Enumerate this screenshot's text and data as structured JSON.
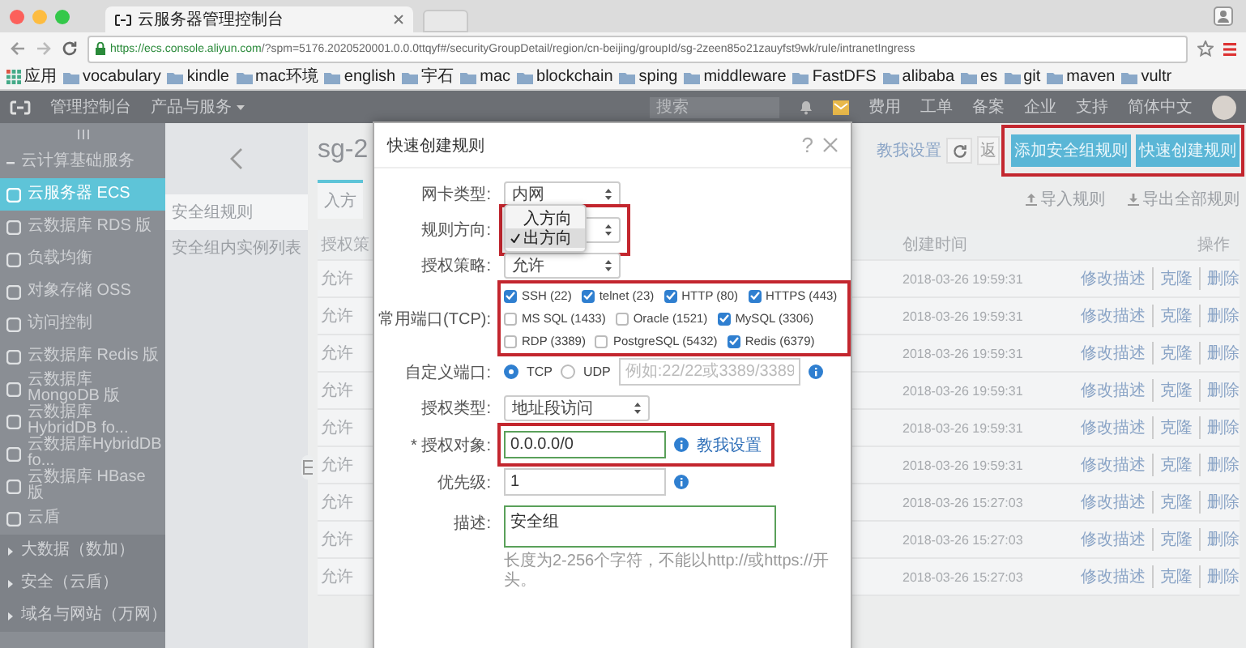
{
  "browser": {
    "tab_title": "云服务器管理控制台",
    "url_origin": "https://ecs.console.aliyun.com",
    "url_path": "/?spm=5176.2020520001.0.0.0ttqyf#/securityGroupDetail/region/cn-beijing/groupId/sg-2zeen85o21zauyfst9wk/rule/intranetIngress",
    "apps": "应用",
    "bookmarks": [
      "vocabulary",
      "kindle",
      "mac环境",
      "english",
      "宇石",
      "mac",
      "blockchain",
      "sping",
      "middleware",
      "FastDFS",
      "alibaba",
      "es",
      "git",
      "maven",
      "vultr"
    ]
  },
  "console_nav": {
    "home": "管理控制台",
    "products": "产品与服务",
    "search_placeholder": "搜索",
    "links": [
      "费用",
      "工单",
      "备案",
      "企业",
      "支持",
      "简体中文"
    ]
  },
  "sidebar": {
    "items": [
      {
        "label": "云计算基础服务",
        "kind": "group",
        "expanded": true,
        "selected": false
      },
      {
        "label": "云服务器 ECS",
        "kind": "item",
        "selected": true
      },
      {
        "label": "云数据库 RDS 版",
        "kind": "item",
        "selected": false
      },
      {
        "label": "负载均衡",
        "kind": "item",
        "selected": false
      },
      {
        "label": "对象存储 OSS",
        "kind": "item",
        "selected": false
      },
      {
        "label": "访问控制",
        "kind": "item",
        "selected": false
      },
      {
        "label": "云数据库 Redis 版",
        "kind": "item",
        "selected": false
      },
      {
        "label": "云数据库 MongoDB 版",
        "kind": "item",
        "selected": false
      },
      {
        "label": "云数据库 HybridDB fo...",
        "kind": "item",
        "selected": false
      },
      {
        "label": "云数据库HybridDB fo...",
        "kind": "item",
        "selected": false
      },
      {
        "label": "云数据库 HBase 版",
        "kind": "item",
        "selected": false
      },
      {
        "label": "云盾",
        "kind": "item",
        "selected": false
      },
      {
        "label": "大数据（数加）",
        "kind": "group",
        "expanded": false,
        "selected": false
      },
      {
        "label": "安全（云盾）",
        "kind": "group",
        "expanded": false,
        "selected": false
      },
      {
        "label": "域名与网站（万网）",
        "kind": "group",
        "expanded": false,
        "selected": false
      }
    ]
  },
  "subnav": {
    "items": [
      {
        "label": "安全组规则",
        "selected": true
      },
      {
        "label": "安全组内实例列表",
        "selected": false
      }
    ]
  },
  "main": {
    "title": "sg-2",
    "help_link": "教我设置",
    "back_button": "返",
    "highlighted": true,
    "buttons": [
      {
        "label": "添加安全组规则"
      },
      {
        "label": "快速创建规则"
      }
    ],
    "tabs": [
      {
        "label": "入方",
        "selected": true
      }
    ],
    "import": "导入规则",
    "export": "导出全部规则",
    "table": {
      "columns": [
        {
          "label": "授权策"
        },
        {
          "label": "创建时间"
        },
        {
          "label": "操作"
        }
      ],
      "rows": [
        {
          "policy": "允许",
          "created": "2018-03-26 19:59:31",
          "actions": [
            "修改描述",
            "克隆",
            "删除"
          ]
        },
        {
          "policy": "允许",
          "created": "2018-03-26 19:59:31",
          "actions": [
            "修改描述",
            "克隆",
            "删除"
          ]
        },
        {
          "policy": "允许",
          "created": "2018-03-26 19:59:31",
          "actions": [
            "修改描述",
            "克隆",
            "删除"
          ]
        },
        {
          "policy": "允许",
          "created": "2018-03-26 19:59:31",
          "actions": [
            "修改描述",
            "克隆",
            "删除"
          ]
        },
        {
          "policy": "允许",
          "created": "2018-03-26 19:59:31",
          "actions": [
            "修改描述",
            "克隆",
            "删除"
          ]
        },
        {
          "policy": "允许",
          "created": "2018-03-26 19:59:31",
          "actions": [
            "修改描述",
            "克隆",
            "删除"
          ]
        },
        {
          "policy": "允许",
          "created": "2018-03-26 15:27:03",
          "actions": [
            "修改描述",
            "克隆",
            "删除"
          ]
        },
        {
          "policy": "允许",
          "created": "2018-03-26 15:27:03",
          "actions": [
            "修改描述",
            "克隆",
            "删除"
          ]
        },
        {
          "policy": "允许",
          "created": "2018-03-26 15:27:03",
          "actions": [
            "修改描述",
            "克隆",
            "删除"
          ]
        }
      ]
    }
  },
  "modal": {
    "title": "快速创建规则",
    "help": "?",
    "fields": [
      {
        "kind": "select",
        "label": "网卡类型:",
        "value": "内网",
        "highlighted": false
      },
      {
        "kind": "dropdown",
        "label": "规则方向:",
        "highlighted": true,
        "options": [
          {
            "label": "入方向",
            "selected": false
          },
          {
            "label": "出方向",
            "selected": true
          }
        ]
      },
      {
        "kind": "select",
        "label": "授权策略:",
        "value": "允许",
        "highlighted": false
      },
      {
        "kind": "checkboxes",
        "label": "常用端口(TCP):",
        "highlighted": true,
        "rows": [
          [
            {
              "label": "SSH (22)",
              "checked": true
            },
            {
              "label": "telnet (23)",
              "checked": true
            },
            {
              "label": "HTTP (80)",
              "checked": true
            },
            {
              "label": "HTTPS (443)",
              "checked": true
            }
          ],
          [
            {
              "label": "MS SQL (1433)",
              "checked": false
            },
            {
              "label": "Oracle (1521)",
              "checked": false
            },
            {
              "label": "MySQL (3306)",
              "checked": true
            }
          ],
          [
            {
              "label": "RDP (3389)",
              "checked": false
            },
            {
              "label": "PostgreSQL (5432)",
              "checked": false
            },
            {
              "label": "Redis (6379)",
              "checked": true
            }
          ]
        ]
      },
      {
        "kind": "radio-input",
        "label": "自定义端口:",
        "highlighted": false,
        "info": true,
        "options": [
          {
            "label": "TCP",
            "selected": true
          },
          {
            "label": "UDP",
            "selected": false
          }
        ],
        "placeholder": "例如:22/22或3389/3389"
      },
      {
        "kind": "select",
        "label": "授权类型:",
        "value": "地址段访问",
        "highlighted": false
      },
      {
        "kind": "input",
        "label": "* 授权对象:",
        "value": "0.0.0.0/0",
        "valid": true,
        "info": true,
        "link": "教我设置",
        "highlighted": true
      },
      {
        "kind": "input",
        "label": "优先级:",
        "value": "1",
        "valid": false,
        "info": true,
        "highlighted": false
      },
      {
        "kind": "textarea",
        "label": "描述:",
        "value": "安全组",
        "valid": true,
        "hint": "长度为2-256个字符，不能以http://或https://开头。",
        "highlighted": false
      }
    ]
  }
}
